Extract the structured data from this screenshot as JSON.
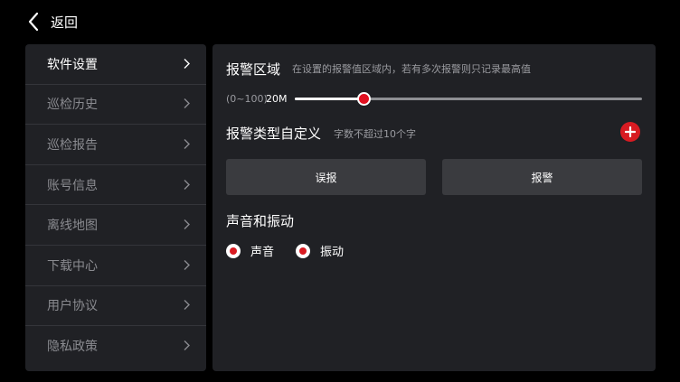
{
  "header": {
    "back_label": "返回"
  },
  "sidebar": {
    "items": [
      {
        "label": "软件设置",
        "active": true
      },
      {
        "label": "巡检历史"
      },
      {
        "label": "巡检报告"
      },
      {
        "label": "账号信息"
      },
      {
        "label": "离线地图"
      },
      {
        "label": "下载中心"
      },
      {
        "label": "用户协议"
      },
      {
        "label": "隐私政策"
      }
    ]
  },
  "alarm_area": {
    "title": "报警区域",
    "hint": "在设置的报警值区域内，若有多次报警则只记录最高值",
    "range_label": "(0~100)",
    "value_label": "20M",
    "slider_value": 20,
    "slider_max": 100
  },
  "alarm_type": {
    "title": "报警类型自定义",
    "hint": "字数不超过10个字",
    "add_icon": "plus-icon",
    "buttons": [
      "误报",
      "报警"
    ]
  },
  "sound_vibration": {
    "title": "声音和振动",
    "options": [
      "声音",
      "振动"
    ]
  },
  "colors": {
    "accent": "#d81b22",
    "panel_bg": "#202125",
    "button_bg": "#3a3b3f",
    "page_bg": "#000000"
  }
}
